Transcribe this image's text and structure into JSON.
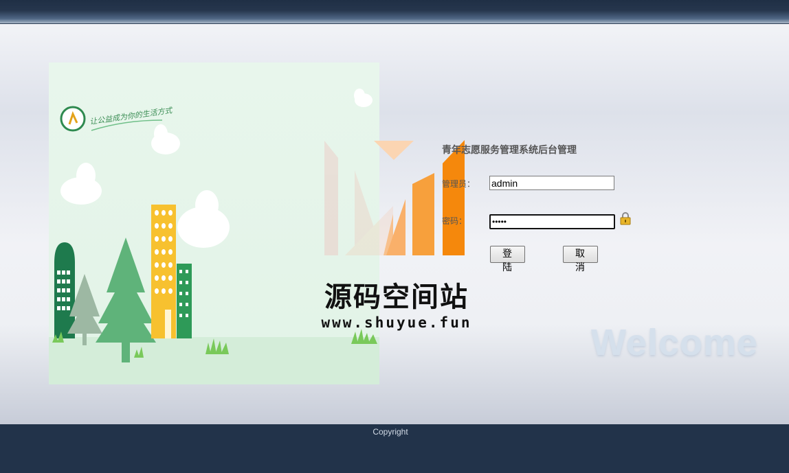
{
  "login": {
    "title": "青年志愿服务管理系统后台管理",
    "username_label": "管理员：",
    "username_value": "admin",
    "password_label": "密码：",
    "password_value": "admin",
    "login_button": "登 陆",
    "cancel_button": "取 消"
  },
  "illustration": {
    "slogan": "让公益成为你的生活方式"
  },
  "watermark": {
    "title": "源码空间站",
    "url": "www.shuyue.fun"
  },
  "welcome_text": "Welcome",
  "footer": {
    "copyright": "Copyright"
  },
  "colors": {
    "header_bg": "#22334a",
    "footer_bg": "#22334a",
    "illustration_bg": "#e6f5ea",
    "watermark_orange": "#f5880c"
  },
  "icons": {
    "lock": "lock-icon",
    "logo": "hand-heart-logo-icon"
  }
}
